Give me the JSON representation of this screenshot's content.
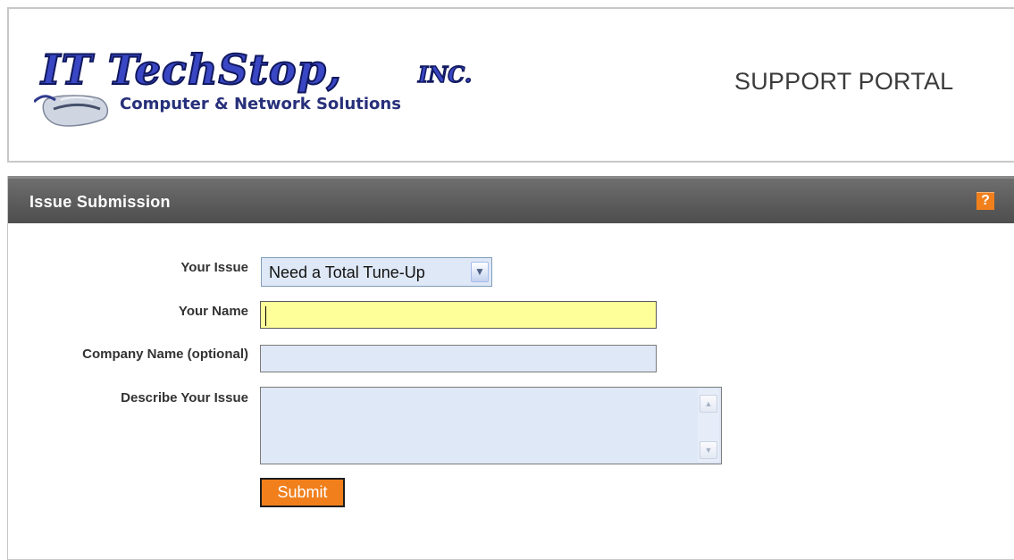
{
  "header": {
    "logo_main_text": "IT TechStop, INC.",
    "logo_tagline": "Computer & Network Solutions",
    "portal_title": "SUPPORT PORTAL"
  },
  "panel": {
    "title": "Issue Submission",
    "help_label": "?"
  },
  "form": {
    "issue_label": "Your Issue",
    "issue_selected": "Need a Total Tune-Up",
    "name_label": "Your Name",
    "name_value": "",
    "company_label": "Company Name (optional)",
    "company_value": "",
    "describe_label": "Describe Your Issue",
    "describe_value": "",
    "submit_label": "Submit"
  },
  "colors": {
    "accent": "#f07f1c",
    "panel_header": "#5a5a5a",
    "input_fill": "#dfe8f6",
    "focused_fill": "#ffff99"
  },
  "icons": {
    "help": "question-mark-icon",
    "dropdown": "chevron-down-icon",
    "scroll_up": "scroll-up-arrow-icon",
    "scroll_down": "scroll-down-arrow-icon",
    "logo_mouse": "computer-mouse-icon"
  }
}
